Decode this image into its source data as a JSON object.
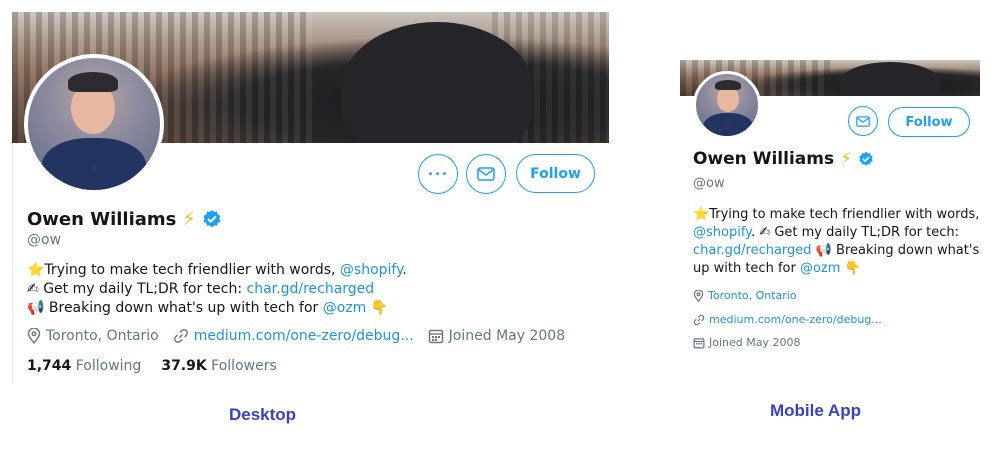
{
  "colors": {
    "accent": "#1da1f2",
    "link": "#1b95e0",
    "muted": "#657786",
    "caption": "#3b3fc4",
    "bolt": "#f5c518"
  },
  "profile": {
    "name": "Owen Williams",
    "handle": "@ow",
    "bio_line1_pre": "Trying to make tech friendlier with words, ",
    "bio_line1_link": "@shopify",
    "bio_line1_post": ".",
    "bio_line2_pre": "Get my daily TL;DR for tech: ",
    "bio_line2_link": "char.gd/recharged",
    "bio_line3_pre": "Breaking down what's up with tech for ",
    "bio_line3_link": "@ozm",
    "location": "Toronto, Ontario",
    "url": "medium.com/one-zero/debug...",
    "joined": "Joined May 2008",
    "following_count": "1,744",
    "following_label": "Following",
    "followers_count": "37.9K",
    "followers_label": "Followers"
  },
  "mobile": {
    "bio_line1": "Trying to make tech friendlier with words,",
    "bio_line2_link": "@shopify",
    "bio_line2_post": ". ",
    "bio_line2_rest": " Get my daily TL;DR for tech:",
    "bio_line3_link": "char.gd/recharged",
    "bio_line3_rest": " Breaking down what's",
    "bio_line4_pre": "up with tech for ",
    "bio_line4_link": "@ozm"
  },
  "buttons": {
    "follow": "Follow",
    "more": "•••"
  },
  "captions": {
    "desktop": "Desktop",
    "mobile": "Mobile App"
  },
  "icons": {
    "bolt": "⚡",
    "star": "⭐",
    "writing_hand": "✍",
    "megaphone": "📢",
    "point_down": "👇"
  }
}
